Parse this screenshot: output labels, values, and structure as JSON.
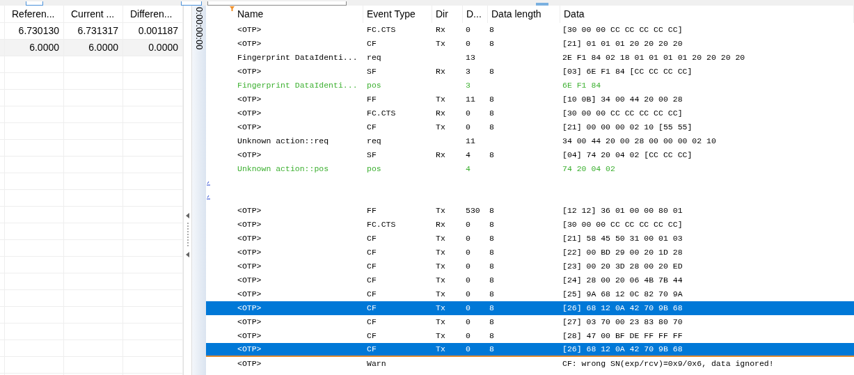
{
  "compare_table": {
    "columns": [
      "Referen...",
      "Current ...",
      "Differen..."
    ],
    "rows": [
      {
        "cells": [
          "6.730130",
          "6.731317",
          "0.001187"
        ],
        "selected": false
      },
      {
        "cells": [
          "6.0000",
          "6.0000",
          "0.0000"
        ],
        "selected": true
      }
    ]
  },
  "timeline": {
    "label": "0:00:00:00"
  },
  "trace": {
    "columns": [
      "Name",
      "Event Type",
      "Dir",
      "D...",
      "Data length",
      "Data"
    ],
    "rows": [
      {
        "kind": "frame",
        "name": "<OTP>",
        "event_type": "FC.CTS",
        "dir": "Rx",
        "d": "0",
        "data_length": "8",
        "data": "[30 00 00 CC CC CC CC CC]",
        "selected": false
      },
      {
        "kind": "frame",
        "name": "<OTP>",
        "event_type": "CF",
        "dir": "Tx",
        "d": "0",
        "data_length": "8",
        "data": "[21] 01 01 01 20 20 20 20",
        "selected": false
      },
      {
        "kind": "request",
        "name": "Fingerprint DataIdenti...",
        "event_type": "req",
        "d": "13",
        "data": "2E F1 84 02 18 01 01 01 01 20 20 20 20",
        "selected": false
      },
      {
        "kind": "frame",
        "name": "<OTP>",
        "event_type": "SF",
        "dir": "Rx",
        "d": "3",
        "data_length": "8",
        "data": "[03] 6E F1 84 [CC CC CC CC]",
        "selected": false
      },
      {
        "kind": "response",
        "name": "Fingerprint DataIdenti...",
        "event_type": "pos",
        "d": "3",
        "data": "6E F1 84",
        "selected": false
      },
      {
        "kind": "frame",
        "name": "<OTP>",
        "event_type": "FF",
        "dir": "Tx",
        "d": "11",
        "data_length": "8",
        "data": "[10 0B] 34 00 44 20 00 28",
        "selected": false
      },
      {
        "kind": "frame",
        "name": "<OTP>",
        "event_type": "FC.CTS",
        "dir": "Rx",
        "d": "0",
        "data_length": "8",
        "data": "[30 00 00 CC CC CC CC CC]",
        "selected": false
      },
      {
        "kind": "frame",
        "name": "<OTP>",
        "event_type": "CF",
        "dir": "Tx",
        "d": "0",
        "data_length": "8",
        "data": "[21] 00 00 00 02 10 [55 55]",
        "selected": false
      },
      {
        "kind": "request",
        "name": "Unknown action::req",
        "event_type": "req",
        "d": "11",
        "data": "34 00 44 20 00 28 00 00 00 02 10",
        "selected": false
      },
      {
        "kind": "frame",
        "name": "<OTP>",
        "event_type": "SF",
        "dir": "Rx",
        "d": "4",
        "data_length": "8",
        "data": "[04] 74 20 04 02 [CC CC CC]",
        "selected": false
      },
      {
        "kind": "response",
        "name": "Unknown action::pos",
        "event_type": "pos",
        "d": "4",
        "data": "74 20 04 02",
        "selected": false
      },
      {
        "kind": "marker",
        "selected": false
      },
      {
        "kind": "marker",
        "selected": false
      },
      {
        "kind": "frame",
        "name": "<OTP>",
        "event_type": "FF",
        "dir": "Tx",
        "d": "530",
        "data_length": "8",
        "data": "[12 12] 36 01 00 00 80 01",
        "selected": false
      },
      {
        "kind": "frame",
        "name": "<OTP>",
        "event_type": "FC.CTS",
        "dir": "Rx",
        "d": "0",
        "data_length": "8",
        "data": "[30 00 00 CC CC CC CC CC]",
        "selected": false
      },
      {
        "kind": "frame",
        "name": "<OTP>",
        "event_type": "CF",
        "dir": "Tx",
        "d": "0",
        "data_length": "8",
        "data": "[21] 58 45 50 31 00 01 03",
        "selected": false
      },
      {
        "kind": "frame",
        "name": "<OTP>",
        "event_type": "CF",
        "dir": "Tx",
        "d": "0",
        "data_length": "8",
        "data": "[22] 00 BD 29 00 20 1D 28",
        "selected": false
      },
      {
        "kind": "frame",
        "name": "<OTP>",
        "event_type": "CF",
        "dir": "Tx",
        "d": "0",
        "data_length": "8",
        "data": "[23] 00 20 3D 28 00 20 ED",
        "selected": false
      },
      {
        "kind": "frame",
        "name": "<OTP>",
        "event_type": "CF",
        "dir": "Tx",
        "d": "0",
        "data_length": "8",
        "data": "[24] 28 00 20 06 4B 7B 44",
        "selected": false
      },
      {
        "kind": "frame",
        "name": "<OTP>",
        "event_type": "CF",
        "dir": "Tx",
        "d": "0",
        "data_length": "8",
        "data": "[25] 9A 68 12 0C 82 70 9A",
        "selected": false
      },
      {
        "kind": "frame",
        "name": "<OTP>",
        "event_type": "CF",
        "dir": "Tx",
        "d": "0",
        "data_length": "8",
        "data": "[26] 68 12 0A 42 70 9B 68",
        "selected": true
      },
      {
        "kind": "frame",
        "name": "<OTP>",
        "event_type": "CF",
        "dir": "Tx",
        "d": "0",
        "data_length": "8",
        "data": "[27] 03 70 00 23 83 80 70",
        "selected": false
      },
      {
        "kind": "frame",
        "name": "<OTP>",
        "event_type": "CF",
        "dir": "Tx",
        "d": "0",
        "data_length": "8",
        "data": "[28] 47 00 BF DE FF FF FF",
        "selected": false
      },
      {
        "kind": "frame",
        "name": "<OTP>",
        "event_type": "CF",
        "dir": "Tx",
        "d": "0",
        "data_length": "8",
        "data": "[26] 68 12 0A 42 70 9B 68",
        "selected": true,
        "focused": true
      },
      {
        "kind": "warning",
        "name": "<OTP>",
        "event_type": "Warn",
        "data": "CF: wrong SN(exp/rcv)=0x9/0x6, data ignored!",
        "selected": false
      }
    ]
  }
}
